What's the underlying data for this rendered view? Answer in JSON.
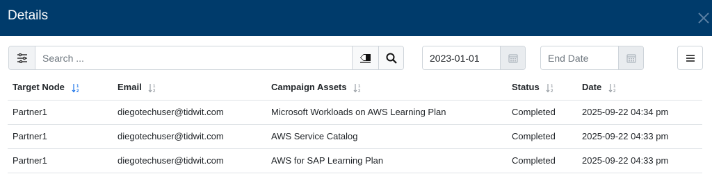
{
  "header": {
    "title": "Details"
  },
  "toolbar": {
    "search_placeholder": "Search ...",
    "search_value": "",
    "start_date_value": "2023-01-01",
    "end_date_placeholder": "End Date"
  },
  "table": {
    "columns": [
      {
        "label": "Target Node",
        "sorted": "active"
      },
      {
        "label": "Email",
        "sorted": "none"
      },
      {
        "label": "Campaign Assets",
        "sorted": "none"
      },
      {
        "label": "Status",
        "sorted": "none"
      },
      {
        "label": "Date",
        "sorted": "none"
      }
    ],
    "rows": [
      {
        "node": "Partner1",
        "email": "diegotechuser@tidwit.com",
        "asset": "Microsoft Workloads on AWS Learning Plan",
        "status": "Completed",
        "date": "2025-09-22 04:34 pm"
      },
      {
        "node": "Partner1",
        "email": "diegotechuser@tidwit.com",
        "asset": "AWS Service Catalog",
        "status": "Completed",
        "date": "2025-09-22 04:33 pm"
      },
      {
        "node": "Partner1",
        "email": "diegotechuser@tidwit.com",
        "asset": "AWS for SAP Learning Plan",
        "status": "Completed",
        "date": "2025-09-22 04:33 pm"
      }
    ]
  },
  "colors": {
    "header_bg": "#003b6b",
    "sort_active": "#1a73e8",
    "sort_inactive": "#9aa0a6",
    "border": "#dee2e6"
  }
}
